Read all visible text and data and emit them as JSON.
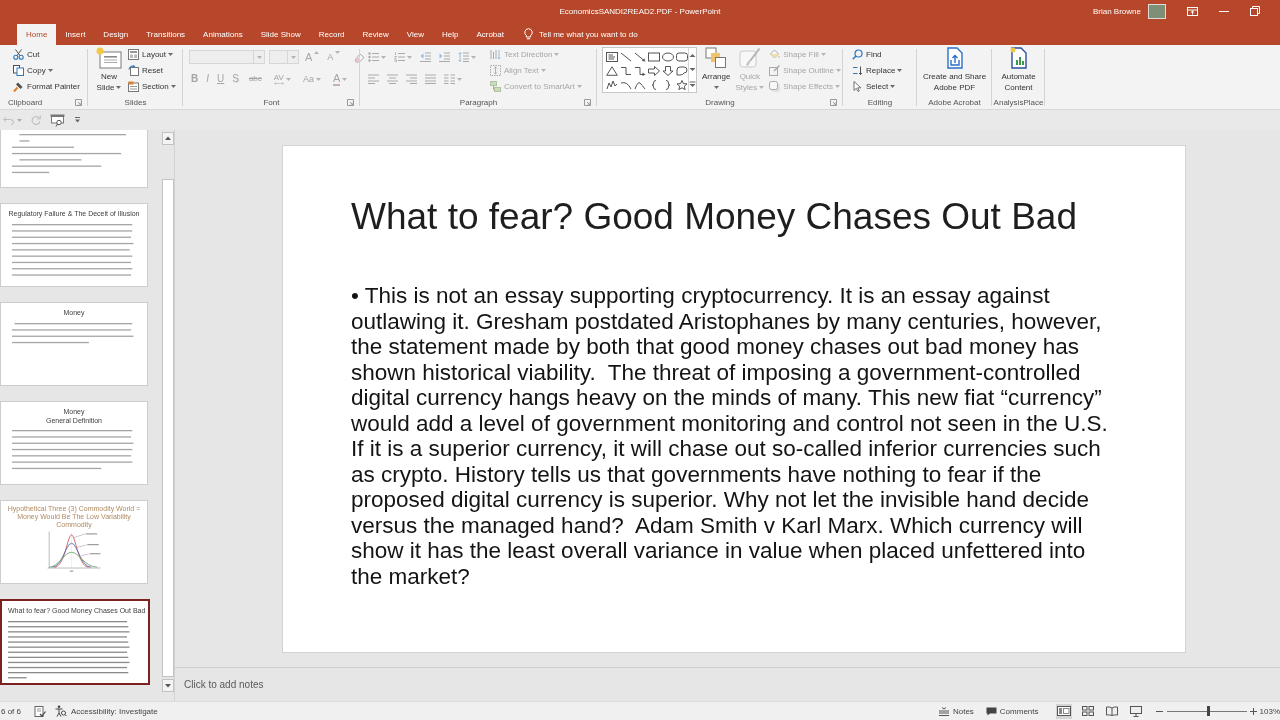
{
  "window": {
    "title": "EconomicsSANDI2READ2.PDF - PowerPoint",
    "user": "Brian Browne"
  },
  "tabs": [
    {
      "label": "Home",
      "selected": true
    },
    {
      "label": "Insert",
      "selected": false
    },
    {
      "label": "Design",
      "selected": false
    },
    {
      "label": "Transitions",
      "selected": false
    },
    {
      "label": "Animations",
      "selected": false
    },
    {
      "label": "Slide Show",
      "selected": false
    },
    {
      "label": "Record",
      "selected": false
    },
    {
      "label": "Review",
      "selected": false
    },
    {
      "label": "View",
      "selected": false
    },
    {
      "label": "Help",
      "selected": false
    },
    {
      "label": "Acrobat",
      "selected": false
    }
  ],
  "tell_me": {
    "placeholder": "Tell me what you want to do"
  },
  "ribbon": [
    {
      "label": "Clipboard",
      "launcher": true,
      "controls": [
        {
          "kind": "cut",
          "label": "Cut",
          "dropdown": false,
          "disabled": false
        },
        {
          "kind": "copy",
          "label": "Copy",
          "dropdown": true,
          "disabled": false
        },
        {
          "kind": "format-painter",
          "label": "Format Painter",
          "dropdown": false,
          "disabled": false
        }
      ]
    },
    {
      "label": "Slides",
      "launcher": false,
      "controls": [
        {
          "kind": "new-slide",
          "lines": [
            "New",
            "Slide"
          ],
          "dropdown": true,
          "disabled": false
        },
        {
          "kind": "layout",
          "label": "Layout",
          "dropdown": true,
          "disabled": false
        },
        {
          "kind": "reset",
          "label": "Reset",
          "dropdown": false,
          "disabled": false
        },
        {
          "kind": "section",
          "label": "Section",
          "dropdown": true,
          "disabled": false
        }
      ]
    },
    {
      "label": "Font",
      "launcher": true,
      "controls": [
        {
          "kind": "font-name",
          "disabled": true
        },
        {
          "kind": "font-size",
          "disabled": true
        },
        {
          "kind": "grow",
          "label": "A",
          "dropdown": false,
          "disabled": true
        },
        {
          "kind": "shrink",
          "label": "A",
          "dropdown": false,
          "disabled": true
        },
        {
          "kind": "clear",
          "dropdown": false,
          "disabled": true
        },
        {
          "kind": "bold",
          "label": "B",
          "dropdown": false,
          "disabled": true
        },
        {
          "kind": "italic",
          "label": "I",
          "dropdown": false,
          "disabled": true
        },
        {
          "kind": "underline",
          "label": "U",
          "dropdown": false,
          "disabled": true
        },
        {
          "kind": "shadow",
          "label": "S",
          "dropdown": false,
          "disabled": true
        },
        {
          "kind": "strikethrough",
          "label": "abc",
          "dropdown": false,
          "disabled": true
        },
        {
          "kind": "spacing",
          "label": "AV",
          "dropdown": true,
          "disabled": true
        },
        {
          "kind": "change-case",
          "label": "Aa",
          "dropdown": true,
          "disabled": true
        },
        {
          "kind": "font-color",
          "label": "A",
          "dropdown": true,
          "disabled": true
        }
      ]
    },
    {
      "label": "Paragraph",
      "launcher": true,
      "controls": [
        {
          "kind": "bullets",
          "dropdown": true,
          "disabled": true
        },
        {
          "kind": "numbering",
          "dropdown": true,
          "disabled": true
        },
        {
          "kind": "outdent",
          "dropdown": false,
          "disabled": true
        },
        {
          "kind": "indent",
          "dropdown": false,
          "disabled": true
        },
        {
          "kind": "line-spacing",
          "dropdown": true,
          "disabled": true
        },
        {
          "kind": "align-left",
          "dropdown": false,
          "disabled": true
        },
        {
          "kind": "align-center",
          "dropdown": false,
          "disabled": true
        },
        {
          "kind": "align-right",
          "dropdown": false,
          "disabled": true
        },
        {
          "kind": "justify",
          "dropdown": false,
          "disabled": true
        },
        {
          "kind": "columns",
          "dropdown": true,
          "disabled": true
        },
        {
          "kind": "text-direction",
          "label": "Text Direction",
          "dropdown": true,
          "disabled": true
        },
        {
          "kind": "align-text",
          "label": "Align Text",
          "dropdown": true,
          "disabled": true
        },
        {
          "kind": "smartart",
          "label": "Convert to SmartArt",
          "dropdown": true,
          "disabled": true
        }
      ]
    },
    {
      "label": "Drawing",
      "launcher": true,
      "controls": [
        {
          "kind": "shapes",
          "disabled": false
        },
        {
          "kind": "arrange",
          "label": "Arrange",
          "dropdown": true,
          "disabled": false
        },
        {
          "kind": "quick-styles",
          "lines": [
            "Quick",
            "Styles"
          ],
          "dropdown": true,
          "disabled": true
        },
        {
          "kind": "shape-fill",
          "label": "Shape Fill",
          "dropdown": true,
          "disabled": true
        },
        {
          "kind": "shape-outline",
          "label": "Shape Outline",
          "dropdown": true,
          "disabled": true
        },
        {
          "kind": "shape-effects",
          "label": "Shape Effects",
          "dropdown": true,
          "disabled": true
        }
      ]
    },
    {
      "label": "Editing",
      "launcher": false,
      "controls": [
        {
          "kind": "find",
          "label": "Find",
          "dropdown": false,
          "disabled": false
        },
        {
          "kind": "replace",
          "label": "Replace",
          "dropdown": true,
          "disabled": false
        },
        {
          "kind": "select",
          "label": "Select",
          "dropdown": true,
          "disabled": false
        }
      ]
    },
    {
      "label": "Adobe Acrobat",
      "launcher": false,
      "controls": [
        {
          "kind": "create-pdf",
          "lines": [
            "Create and Share",
            "Adobe PDF"
          ],
          "dropdown": false,
          "disabled": false
        }
      ]
    },
    {
      "label": "AnalysisPlace",
      "launcher": false,
      "controls": [
        {
          "kind": "automate",
          "lines": [
            "Automate",
            "Content"
          ],
          "dropdown": false,
          "disabled": false
        }
      ]
    }
  ],
  "quick_access": [
    {
      "kind": "undo",
      "dropdown": true,
      "disabled": true
    },
    {
      "kind": "repeat",
      "dropdown": false,
      "disabled": true
    },
    {
      "kind": "presenter",
      "dropdown": false,
      "disabled": false
    },
    {
      "kind": "customize",
      "dropdown": false,
      "disabled": false
    }
  ],
  "slides": [
    {
      "kind": "text",
      "selected": false
    },
    {
      "kind": "text",
      "title": "Regulatory Failure & The Deceit of Illusion",
      "selected": false
    },
    {
      "kind": "text",
      "title": "Money",
      "selected": false
    },
    {
      "kind": "text",
      "title": "Money",
      "subtitle": "General Definition",
      "selected": false
    },
    {
      "kind": "chart",
      "title": "Hypothetical Three (3) Commodity World = Money Would Be The Low Variability Commodity",
      "selected": false
    },
    {
      "kind": "bullets",
      "title": "What to fear? Good Money Chases Out Bad",
      "selected": true
    }
  ],
  "slide": {
    "title": "What to fear? Good Money Chases Out Bad",
    "body": "• This is not an essay supporting cryptocurrency. It is an essay against outlawing it. Gresham postdated Aristophanes by many centuries, however, the statement made by both that good money chases out bad money has shown historical viability.  The threat of imposing a government-controlled digital currency hangs heavy on the minds of many. This new fiat “currency” would add a level of government monitoring and control not seen in the U.S. If it is a superior currency, it will chase out so-called inferior currencies such as crypto. History tells us that governments have nothing to fear if the proposed digital currency is superior. Why not let the invisible hand decide versus the managed hand?  Adam Smith v Karl Marx. Which currency will show it has the least overall variance in value when placed unfettered into the market?"
  },
  "notes": {
    "placeholder": "Click to add notes"
  },
  "status_bar": {
    "slide_counter": "6 of 6",
    "accessibility": "Accessibility: Investigate",
    "notes": "Notes",
    "comments": "Comments",
    "views": [
      {
        "kind": "normal",
        "selected": true
      },
      {
        "kind": "sorter",
        "selected": false
      },
      {
        "kind": "reading",
        "selected": false
      },
      {
        "kind": "slideshow",
        "selected": false
      }
    ],
    "zoom": {
      "level": 0.52,
      "reading": "103%"
    }
  }
}
